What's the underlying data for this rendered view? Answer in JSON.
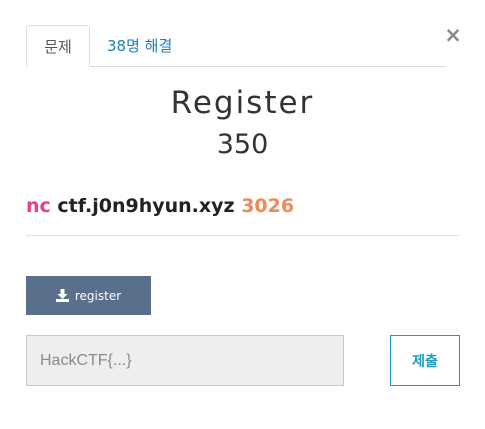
{
  "close": {
    "label": "×"
  },
  "tabs": [
    {
      "label": "문제",
      "active": true
    },
    {
      "label": "38명 해결",
      "active": false
    }
  ],
  "challenge": {
    "name": "Register",
    "points": "350",
    "description": {
      "command": "nc",
      "host": "ctf.j0n9hyun.xyz",
      "port": "3026"
    }
  },
  "file": {
    "label": "register",
    "icon": "download-icon"
  },
  "flag": {
    "placeholder": "HackCTF{...}",
    "value": ""
  },
  "submit": {
    "label": "제출"
  },
  "colors": {
    "link": "#1c7fb8",
    "command": "#e83e8c",
    "port": "#ee8a55",
    "file_button": "#5a6f8c",
    "submit_border": "#1c9bbf"
  }
}
